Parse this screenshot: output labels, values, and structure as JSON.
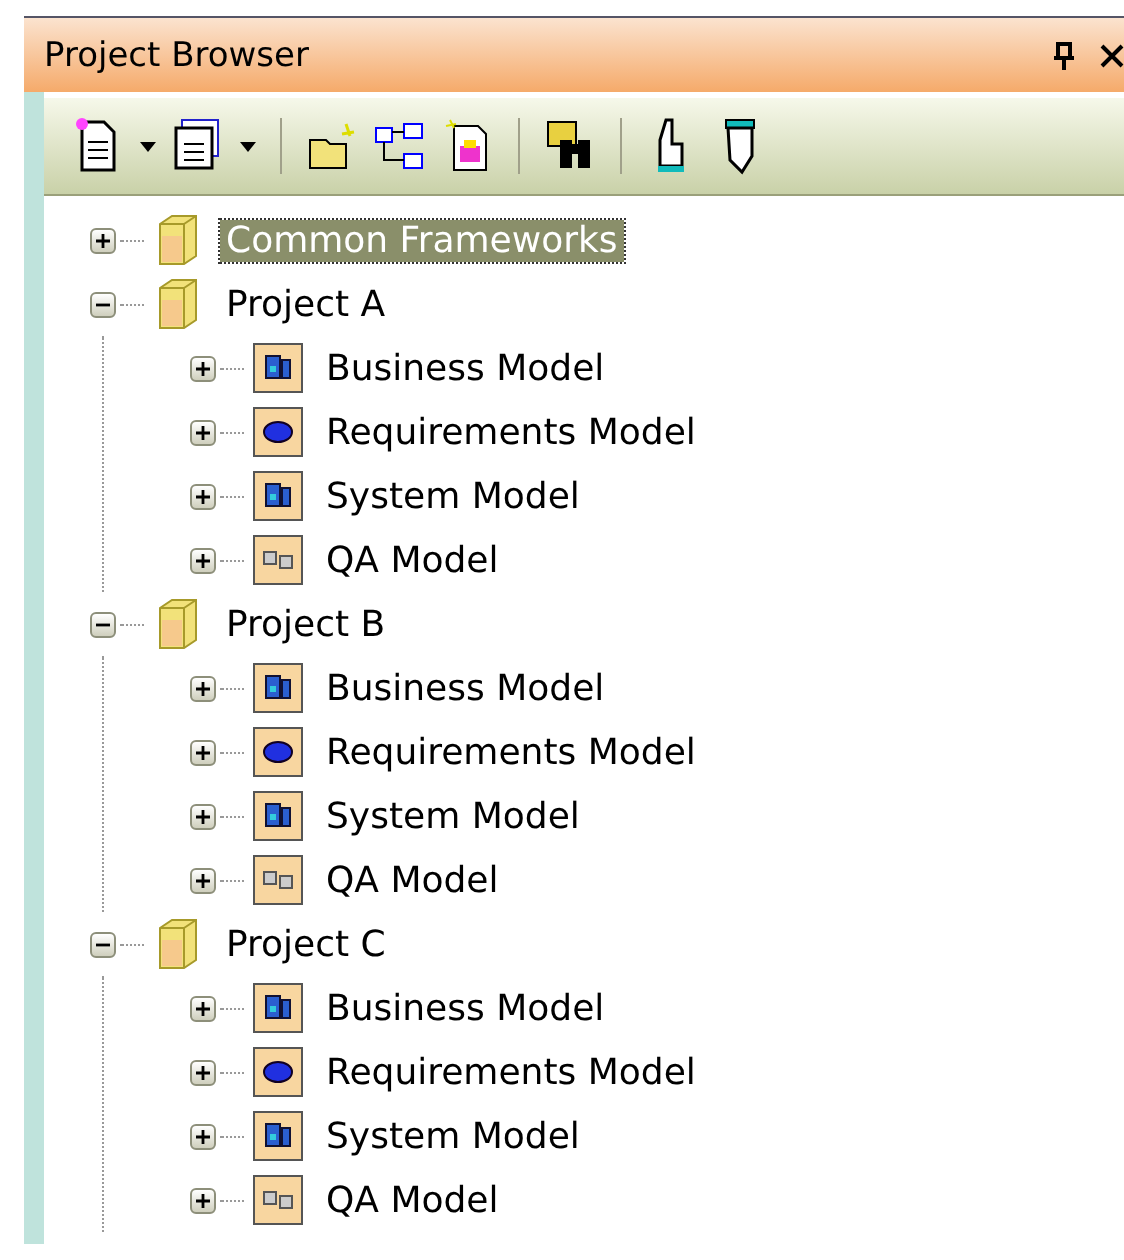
{
  "panel": {
    "title": "Project Browser"
  },
  "tree": [
    {
      "label": "Common Frameworks",
      "kind": "package",
      "expanded": false,
      "selected": true
    },
    {
      "label": "Project A",
      "kind": "package",
      "expanded": true,
      "selected": false,
      "children": [
        {
          "label": "Business Model",
          "kind": "business",
          "expanded": false,
          "selected": false
        },
        {
          "label": "Requirements Model",
          "kind": "requirements",
          "expanded": false,
          "selected": false
        },
        {
          "label": "System Model",
          "kind": "system",
          "expanded": false,
          "selected": false
        },
        {
          "label": "QA Model",
          "kind": "qa",
          "expanded": false,
          "selected": false
        }
      ]
    },
    {
      "label": "Project B",
      "kind": "package",
      "expanded": true,
      "selected": false,
      "children": [
        {
          "label": "Business Model",
          "kind": "business",
          "expanded": false,
          "selected": false
        },
        {
          "label": "Requirements Model",
          "kind": "requirements",
          "expanded": false,
          "selected": false
        },
        {
          "label": "System Model",
          "kind": "system",
          "expanded": false,
          "selected": false
        },
        {
          "label": "QA Model",
          "kind": "qa",
          "expanded": false,
          "selected": false
        }
      ]
    },
    {
      "label": "Project C",
      "kind": "package",
      "expanded": true,
      "selected": false,
      "children": [
        {
          "label": "Business Model",
          "kind": "business",
          "expanded": false,
          "selected": false
        },
        {
          "label": "Requirements Model",
          "kind": "requirements",
          "expanded": false,
          "selected": false
        },
        {
          "label": "System Model",
          "kind": "system",
          "expanded": false,
          "selected": false
        },
        {
          "label": "QA Model",
          "kind": "qa",
          "expanded": false,
          "selected": false
        }
      ]
    }
  ]
}
